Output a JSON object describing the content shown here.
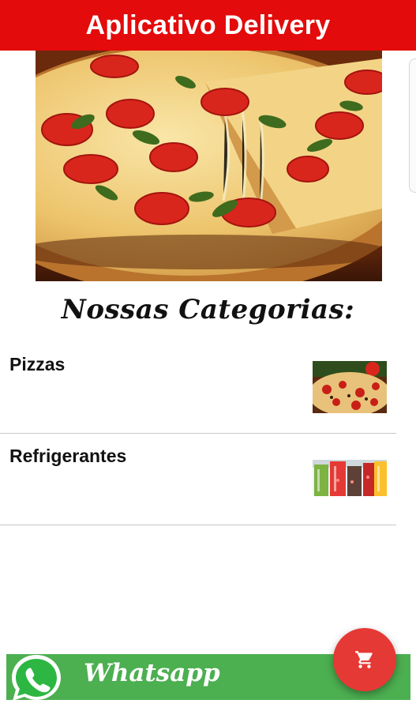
{
  "app": {
    "title": "Aplicativo Delivery"
  },
  "hero": {
    "image": "pizza-hero-image"
  },
  "section": {
    "title": "Nossas Categorias:"
  },
  "categories": [
    {
      "label": "Pizzas",
      "image": "pizza-thumbnail"
    },
    {
      "label": "Refrigerantes",
      "image": "soda-thumbnail"
    }
  ],
  "whatsapp": {
    "label": "Whatsapp",
    "icon": "whatsapp-icon"
  },
  "fab": {
    "icon": "cart-icon"
  },
  "colors": {
    "primary": "#e30b0b",
    "whatsapp": "#4caf50",
    "fab": "#e53935"
  }
}
